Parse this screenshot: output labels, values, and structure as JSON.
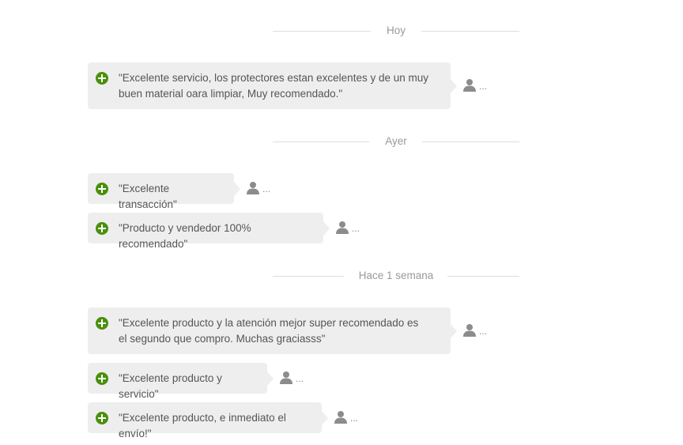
{
  "groups": [
    {
      "label": "Hoy",
      "reviews": [
        {
          "text": "\"Excelente servicio, los protectores estan excelentes y de un muy buen material oara limpiar, Muy recomendado.\"",
          "author": "..."
        }
      ]
    },
    {
      "label": "Ayer",
      "reviews": [
        {
          "text": "\"Excelente transacción\"",
          "author": "..."
        },
        {
          "text": "\"Producto y vendedor 100% recomendado\"",
          "author": "..."
        }
      ]
    },
    {
      "label": "Hace 1 semana",
      "reviews": [
        {
          "text": "\"Excelente producto y la atención mejor super recomendado es el segundo que compro. Muchas graciasss\"",
          "author": "..."
        },
        {
          "text": "\"Excelente producto y servicio\"",
          "author": "..."
        },
        {
          "text": "\"Excelente producto, e inmediato el envío!\"",
          "author": "..."
        }
      ]
    }
  ],
  "icons": {
    "positive": "plus-circle-icon",
    "user": "user-silhouette-icon"
  },
  "colors": {
    "positive_green": "#4a8f0b",
    "bubble_bg": "#eeeeee",
    "divider_line": "#dedede",
    "divider_text": "#999999",
    "icon_gray": "#8c8c8c"
  }
}
